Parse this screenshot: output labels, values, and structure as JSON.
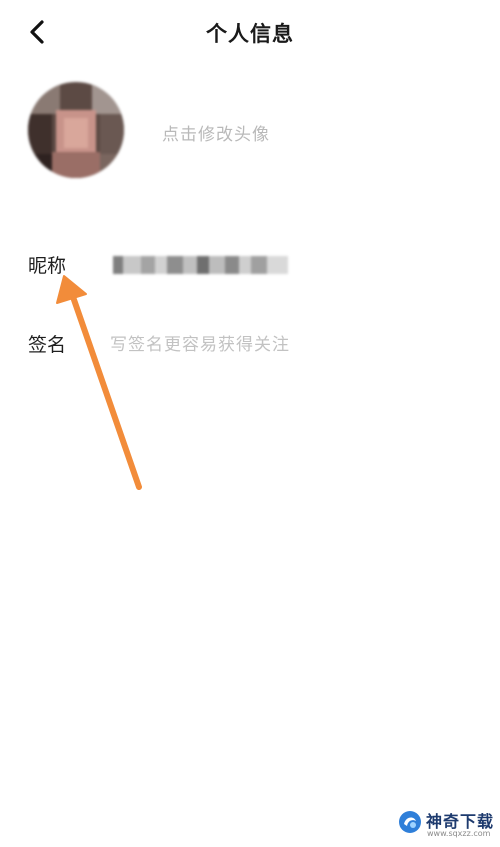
{
  "header": {
    "title": "个人信息",
    "back_icon": "chevron-left-icon"
  },
  "avatar": {
    "hint": "点击修改头像"
  },
  "fields": {
    "nickname": {
      "label": "昵称",
      "value_blurred": true
    },
    "signature": {
      "label": "签名",
      "value": "",
      "placeholder": "写签名更容易获得关注"
    }
  },
  "annotation": {
    "arrow_color": "#f28c3a"
  },
  "watermark": {
    "name": "神奇下载",
    "url": "www.sqxzz.com",
    "logo_icon": "sqxzz-logo"
  },
  "colors": {
    "background": "#ffffff",
    "text_primary": "#1a1a1a",
    "placeholder": "#c2c2c2",
    "arrow": "#f28c3a"
  }
}
